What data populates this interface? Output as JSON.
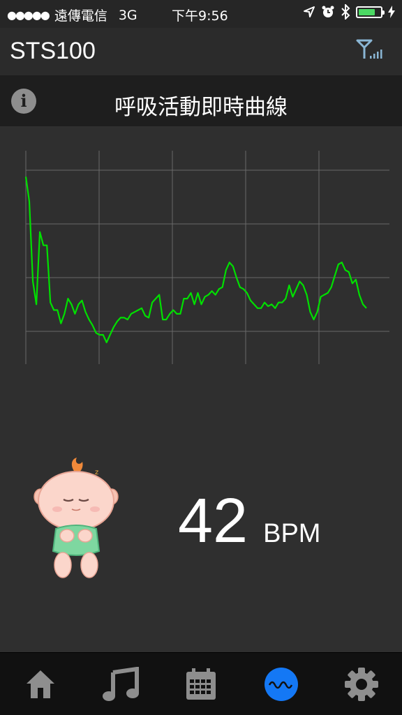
{
  "status_bar": {
    "signal_dots": "●●●●●",
    "carrier": "遠傳電信",
    "network": "3G",
    "time": "下午9:56",
    "battery_level": 0.75,
    "icons": [
      "location-arrow-icon",
      "alarm-icon",
      "bluetooth-icon",
      "battery-icon",
      "charging-bolt-icon"
    ]
  },
  "header": {
    "app_title": "STS100",
    "signal_icon": "antenna-signal-icon"
  },
  "subheader": {
    "info_icon_glyph": "i",
    "title": "呼吸活動即時曲線"
  },
  "chart_data": {
    "type": "line",
    "title": "",
    "xlabel": "",
    "ylabel": "",
    "grid": true,
    "line_color": "#00e000",
    "xlim": [
      0,
      100
    ],
    "ylim": [
      0,
      100
    ],
    "series": [
      {
        "values": [
          94,
          81,
          39,
          27,
          65,
          58,
          58,
          28,
          24,
          24,
          17,
          22,
          30,
          27,
          22,
          27,
          29,
          23,
          19,
          16,
          12,
          11,
          11,
          7,
          11,
          15,
          18,
          20,
          20,
          19,
          22,
          23,
          24,
          25,
          21,
          20,
          28,
          30,
          32,
          19,
          19,
          22,
          24,
          22,
          22,
          30,
          30,
          33,
          27,
          33,
          27,
          31,
          32,
          34,
          32,
          35,
          36,
          45,
          49,
          47,
          41,
          36,
          35,
          33,
          29,
          27,
          25,
          25,
          28,
          26,
          27,
          25,
          28,
          28,
          30,
          37,
          31,
          35,
          39,
          37,
          32,
          23,
          19,
          23,
          31,
          32,
          33,
          36,
          42,
          48,
          49,
          45,
          44,
          38,
          40,
          32,
          27,
          25
        ]
      }
    ]
  },
  "reading": {
    "value": "42",
    "unit": "BPM",
    "mascot": "sleeping-baby-icon"
  },
  "tabbar": {
    "items": [
      {
        "name": "home-icon",
        "active": false
      },
      {
        "name": "music-note-icon",
        "active": false
      },
      {
        "name": "calendar-icon",
        "active": false
      },
      {
        "name": "wave-icon",
        "active": true
      },
      {
        "name": "gear-icon",
        "active": false
      }
    ],
    "active_color": "#1478f5",
    "inactive_color": "#8e8e8e"
  }
}
